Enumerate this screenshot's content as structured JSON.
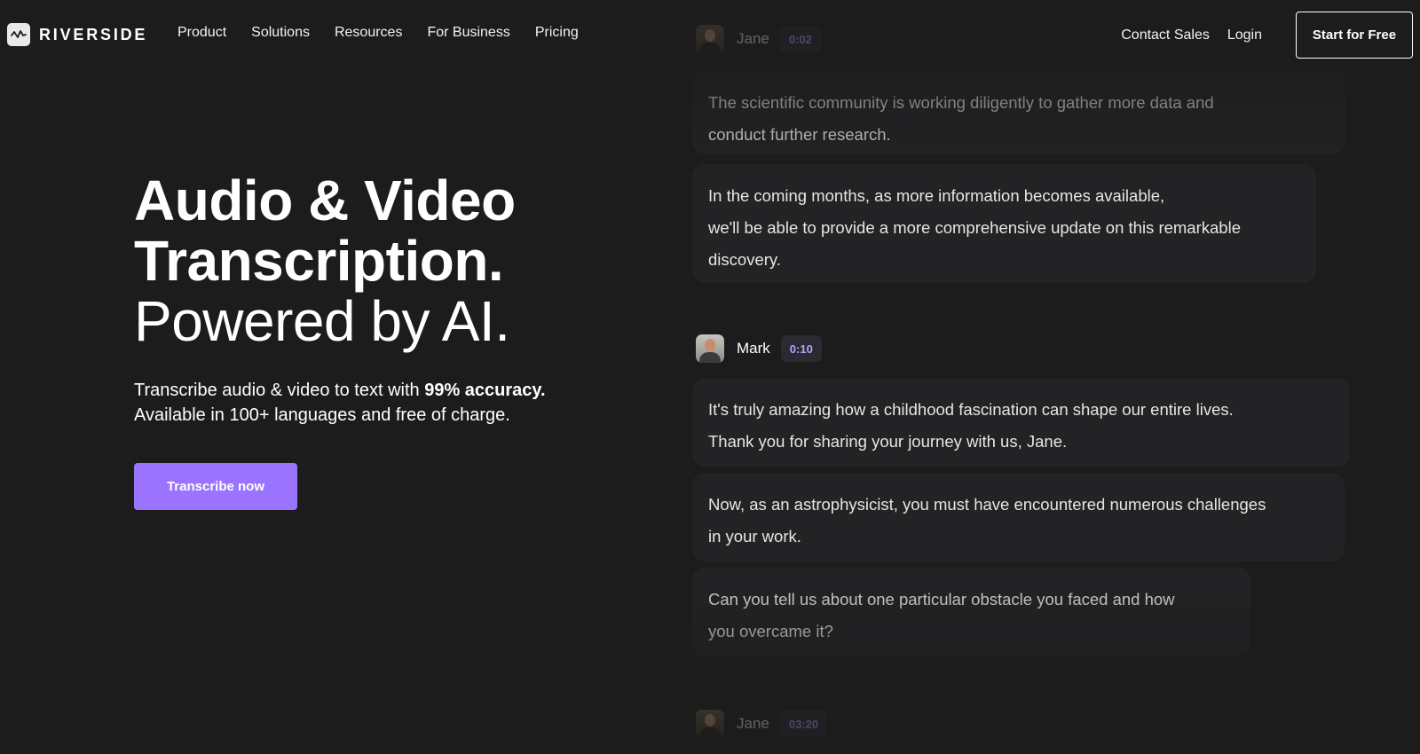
{
  "brand": {
    "name": "RIVERSIDE",
    "logo_icon": "waveform-icon"
  },
  "nav": {
    "links": [
      "Product",
      "Solutions",
      "Resources",
      "For Business",
      "Pricing"
    ],
    "contact_sales": "Contact Sales",
    "login": "Login",
    "start_free": "Start for Free"
  },
  "hero": {
    "title_line1": "Audio & Video",
    "title_line2": "Transcription.",
    "title_line3": "Powered by AI.",
    "sub_line1_prefix": "Transcribe audio & video to text with ",
    "sub_line1_bold": "99% accuracy.",
    "sub_line2": "Available in 100+ languages and free of charge.",
    "cta": "Transcribe now"
  },
  "transcript": {
    "blocks": [
      {
        "speaker": "Jane",
        "time": "0:02",
        "messages": [
          "The scientific community is working diligently to gather more data and\nconduct further research.",
          " In the coming months, as more information becomes available,\nwe'll be able to provide a more comprehensive update on this remarkable\ndiscovery."
        ]
      },
      {
        "speaker": "Mark",
        "time": "0:10",
        "messages": [
          "It's truly amazing how a childhood fascination can shape our entire lives.\nThank you for sharing your journey with us, Jane.",
          "Now, as an astrophysicist, you must have encountered numerous challenges\nin your work.",
          "Can you tell us about one particular obstacle you faced and how\nyou overcame it?"
        ]
      },
      {
        "speaker": "Jane",
        "time": "03:20",
        "messages": []
      }
    ]
  },
  "colors": {
    "background": "#1c1c1d",
    "accent": "#9a74ff",
    "bubble": "#232325",
    "timestamp_text": "#b9a1ff"
  }
}
